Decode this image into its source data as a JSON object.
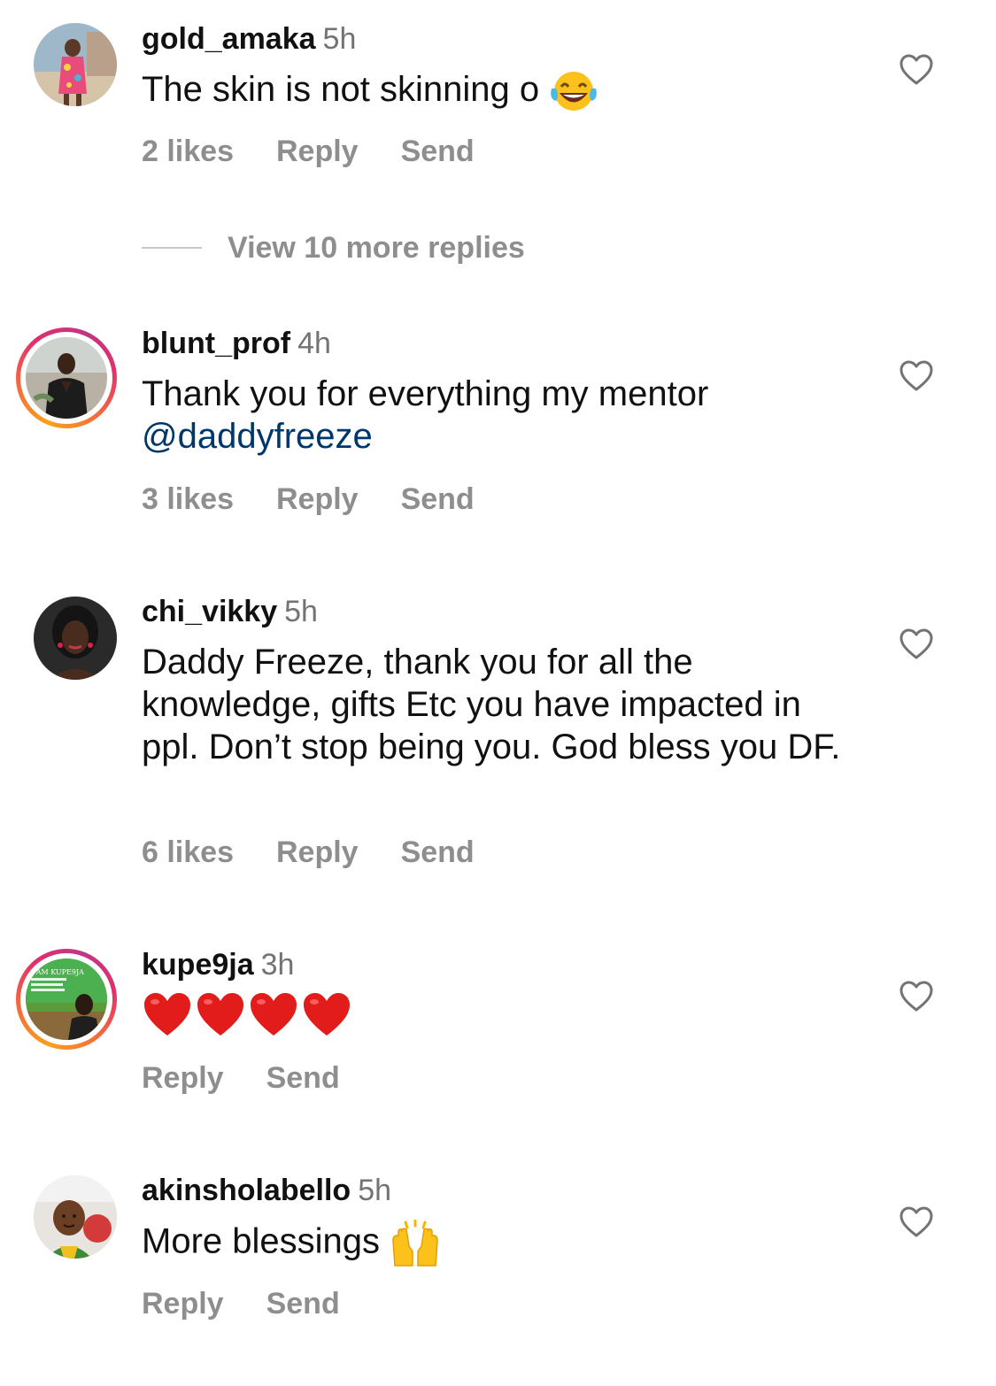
{
  "comments": [
    {
      "username": "gold_amaka",
      "time": "5h",
      "text": "The skin is not skinning o",
      "emoji": "laughing-tears",
      "likes": "2 likes",
      "reply": "Reply",
      "send": "Send",
      "view_more": "View 10 more replies",
      "has_story_ring": false
    },
    {
      "username": "blunt_prof",
      "time": "4h",
      "text": "Thank you for everything my mentor",
      "mention": "@daddyfreeze",
      "likes": "3 likes",
      "reply": "Reply",
      "send": "Send",
      "has_story_ring": true
    },
    {
      "username": "chi_vikky",
      "time": "5h",
      "text": "Daddy Freeze, thank you for all the knowledge, gifts Etc you have impacted in ppl. Don’t stop being you. God bless you DF.",
      "likes": "6 likes",
      "reply": "Reply",
      "send": "Send",
      "has_story_ring": false
    },
    {
      "username": "kupe9ja",
      "time": "3h",
      "emoji": "red-heart x4",
      "reply": "Reply",
      "send": "Send",
      "has_story_ring": true,
      "avatar_text": "I AM KUPE9JA"
    },
    {
      "username": "akinsholabello",
      "time": "5h",
      "text": "More blessings",
      "emoji": "raising-hands",
      "reply": "Reply",
      "send": "Send",
      "has_story_ring": false
    }
  ],
  "colors": {
    "meta_gray": "#8e8e8e",
    "time_gray": "#737373",
    "mention_blue": "#00376b",
    "ring_gradient": [
      "#f9a11b",
      "#e1306c",
      "#c13584"
    ]
  },
  "icons": {
    "like": "heart-outline-icon"
  }
}
